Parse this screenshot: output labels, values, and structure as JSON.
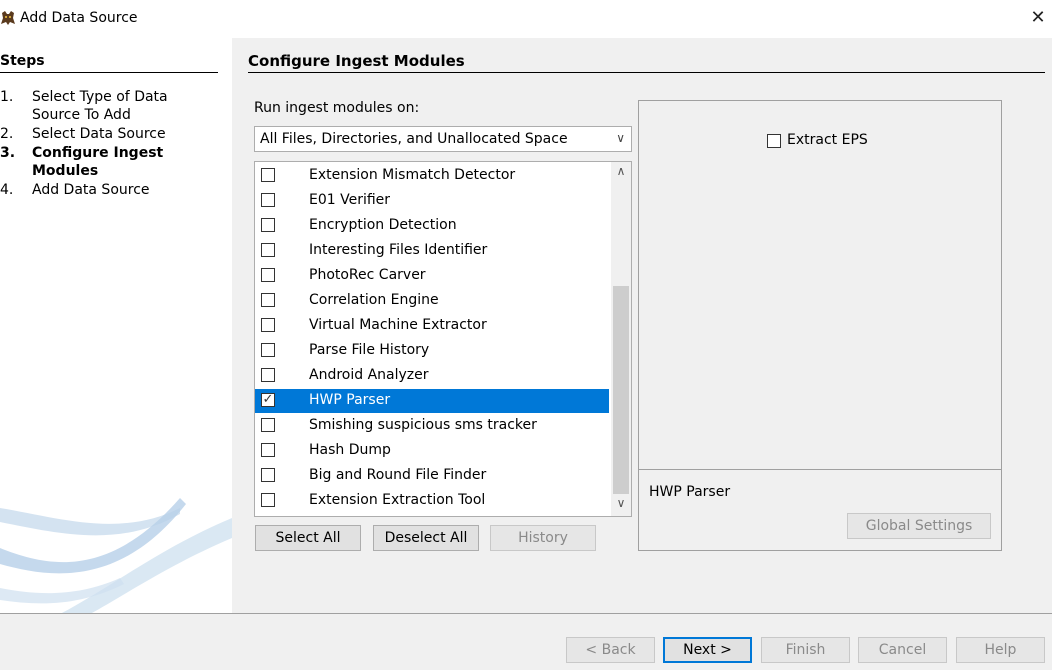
{
  "window": {
    "title": "Add Data Source",
    "app_icon": "autopsy-dog-icon",
    "close_glyph": "✕"
  },
  "steps": {
    "heading": "Steps",
    "items": [
      {
        "num": "1.",
        "label": "Select Type of Data Source To Add",
        "current": false
      },
      {
        "num": "2.",
        "label": "Select Data Source",
        "current": false
      },
      {
        "num": "3.",
        "label": "Configure Ingest Modules",
        "current": true
      },
      {
        "num": "4.",
        "label": "Add Data Source",
        "current": false
      }
    ]
  },
  "content": {
    "heading": "Configure Ingest Modules",
    "run_label": "Run ingest modules on:",
    "scope_value": "All Files, Directories, and Unallocated Space"
  },
  "modules": [
    {
      "name": "Extension Mismatch Detector",
      "checked": false,
      "selected": false
    },
    {
      "name": "E01 Verifier",
      "checked": false,
      "selected": false
    },
    {
      "name": "Encryption Detection",
      "checked": false,
      "selected": false
    },
    {
      "name": "Interesting Files Identifier",
      "checked": false,
      "selected": false
    },
    {
      "name": "PhotoRec Carver",
      "checked": false,
      "selected": false
    },
    {
      "name": "Correlation Engine",
      "checked": false,
      "selected": false
    },
    {
      "name": "Virtual Machine Extractor",
      "checked": false,
      "selected": false
    },
    {
      "name": "Parse File History",
      "checked": false,
      "selected": false
    },
    {
      "name": "Android Analyzer",
      "checked": false,
      "selected": false
    },
    {
      "name": "HWP Parser",
      "checked": true,
      "selected": true
    },
    {
      "name": "Smishing suspicious sms tracker",
      "checked": false,
      "selected": false
    },
    {
      "name": "Hash Dump",
      "checked": false,
      "selected": false
    },
    {
      "name": "Big and Round File Finder",
      "checked": false,
      "selected": false
    },
    {
      "name": "Extension Extraction Tool",
      "checked": false,
      "selected": false
    }
  ],
  "list_buttons": {
    "select_all": "Select All",
    "deselect_all": "Deselect All",
    "history": "History"
  },
  "settings": {
    "extract_eps_label": "Extract EPS",
    "extract_eps_checked": false,
    "module_title": "HWP Parser",
    "global_settings": "Global Settings"
  },
  "nav": {
    "back": "< Back",
    "next": "Next >",
    "finish": "Finish",
    "cancel": "Cancel",
    "help": "Help"
  },
  "colors": {
    "selection": "#0078d7",
    "panel_bg": "#f0f0f0"
  }
}
